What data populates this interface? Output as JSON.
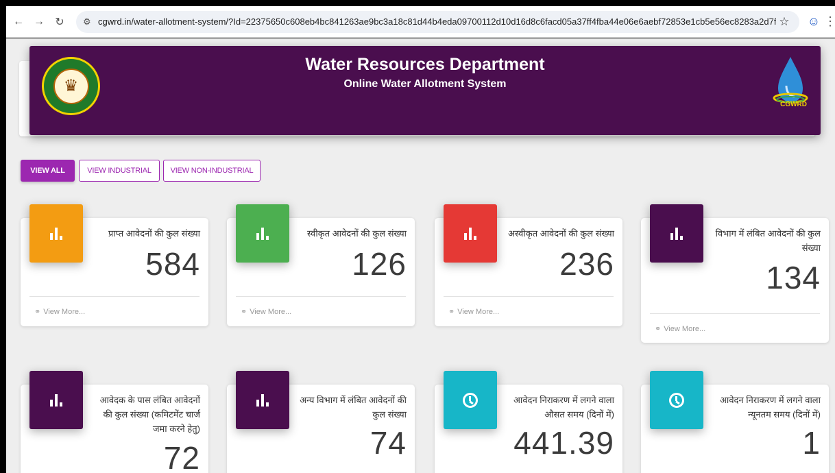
{
  "browser": {
    "url_domain": "cgwrd.in",
    "url_path": "/water-allotment-system/?Id=22375650c608eb4bc841263ae9bc3a18c81d44b4eda09700112d10d16d8c6facd05a37ff4fba44e06e6aebf72853e1cb5e56ec8283a2d7f91..."
  },
  "header": {
    "title": "Water Resources Department",
    "subtitle": "Online Water Allotment System",
    "logo_text": "CGWRD",
    "accent_color": "#4a0e4e"
  },
  "filters": {
    "view_all": "VIEW ALL",
    "view_industrial": "VIEW INDUSTRIAL",
    "view_non_industrial": "VIEW NON-INDUSTRIAL"
  },
  "cards": [
    {
      "label": "प्राप्त आवेदनों की कुल संख्या",
      "value": "584",
      "link": "View More...",
      "color": "#f39c12",
      "icon": "bar-chart-icon"
    },
    {
      "label": "स्वीकृत आवेदनों की कुल संख्या",
      "value": "126",
      "link": "View More...",
      "color": "#4caf50",
      "icon": "bar-chart-icon"
    },
    {
      "label": "अस्वीकृत आवेदनों की कुल संख्या",
      "value": "236",
      "link": "View More...",
      "color": "#e53935",
      "icon": "bar-chart-icon"
    },
    {
      "label": "विभाग में लंबित आवेदनों की कुल संख्या",
      "value": "134",
      "link": "View More...",
      "color": "#4a0e4e",
      "icon": "bar-chart-icon"
    },
    {
      "label": "आवेदक के पास लंबित आवेदनों की कुल संख्या (कमिटमेंट चार्ज जमा करने हेतु)",
      "value": "72",
      "color": "#4a0e4e",
      "icon": "bar-chart-icon"
    },
    {
      "label": "अन्य विभाग में लंबित आवेदनों की कुल संख्या",
      "value": "74",
      "color": "#4a0e4e",
      "icon": "bar-chart-icon"
    },
    {
      "label": "आवेदन निराकरण में लगने वाला औसत समय (दिनों में)",
      "value": "441.39",
      "color": "#17b6c8",
      "icon": "clock-icon"
    },
    {
      "label": "आवेदन निराकरण में लगने वाला न्यूनतम समय (दिनों में)",
      "value": "1",
      "color": "#17b6c8",
      "icon": "clock-icon"
    }
  ]
}
